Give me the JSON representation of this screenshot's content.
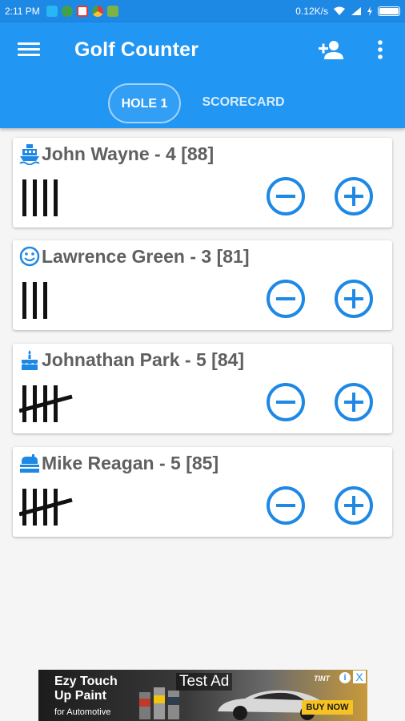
{
  "status_bar": {
    "time": "2:11 PM",
    "speed": "0.12K/s",
    "notifications": [
      "bluetooth-icon",
      "whatsapp-icon",
      "gmail-icon",
      "chrome-icon",
      "message-icon"
    ]
  },
  "app_bar": {
    "title": "Golf Counter",
    "color": "#2196f3"
  },
  "tabs": [
    {
      "label": "HOLE 1",
      "active": true
    },
    {
      "label": "SCORECARD",
      "active": false
    }
  ],
  "players": [
    {
      "name": "John Wayne",
      "hole_score": 4,
      "total": 88,
      "label": "John Wayne - 4 [88]",
      "icon": "boat-icon"
    },
    {
      "name": "Lawrence Green",
      "hole_score": 3,
      "total": 81,
      "label": "Lawrence Green - 3 [81]",
      "icon": "smiley-icon"
    },
    {
      "name": "Johnathan Park",
      "hole_score": 5,
      "total": 84,
      "label": "Johnathan Park - 5 [84]",
      "icon": "cake-icon"
    },
    {
      "name": "Mike Reagan",
      "hole_score": 5,
      "total": 85,
      "label": "Mike Reagan - 5 [85]",
      "icon": "hand-icon"
    }
  ],
  "ad": {
    "headline": "Ezy Touch Up Paint",
    "subline": "for Automotive",
    "badge": "Test Ad",
    "cta": "BUY NOW",
    "info": "i",
    "close": "X"
  },
  "accent_color": "#1e88e5"
}
